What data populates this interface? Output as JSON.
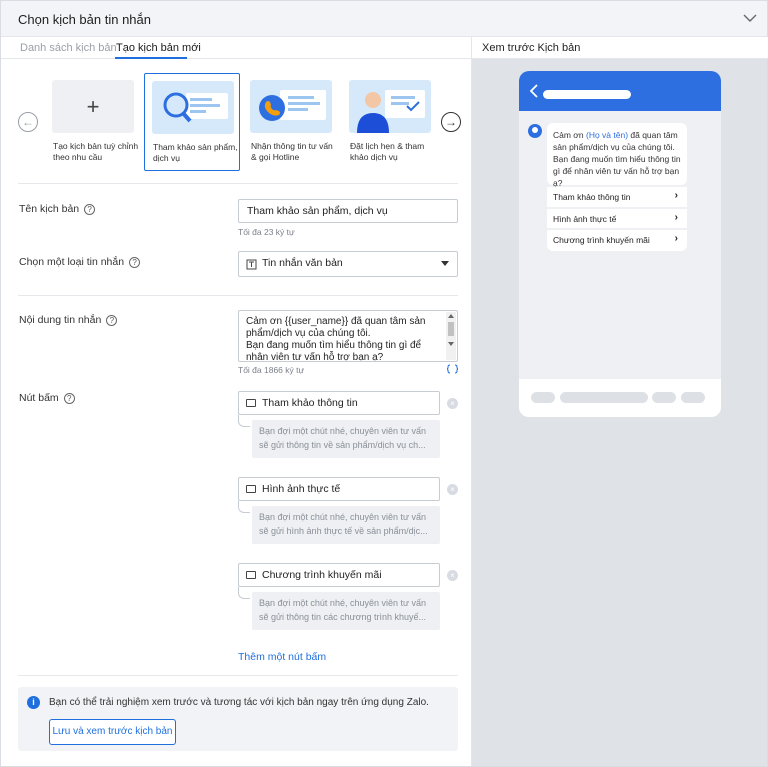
{
  "header": {
    "title": "Chọn kịch bản tin nhắn"
  },
  "tabs": [
    {
      "label": "Danh sách kịch bản"
    },
    {
      "label": "Tạo kịch bản mới"
    }
  ],
  "preview": {
    "title": "Xem trước Kịch bản"
  },
  "templates": [
    {
      "label": "Tạo kịch bản tuỳ chỉnh theo nhu cầu"
    },
    {
      "label": "Tham khảo sản phẩm, dịch vụ"
    },
    {
      "label": "Nhận thông tin tư vấn & gọi Hotline"
    },
    {
      "label": "Đặt lịch hẹn & tham khảo dịch vụ"
    }
  ],
  "form": {
    "name_label": "Tên kịch bản",
    "name_value": "Tham khảo sản phẩm, dịch vụ",
    "name_hint": "Tối đa 23 ký tự",
    "type_label": "Chọn một loại tin nhắn",
    "type_value": "Tin nhắn văn bản",
    "content_label": "Nội dung tin nhắn",
    "content_value": "Cảm ơn {{user_name}} đã quan tâm sản phẩm/dịch vụ của chúng tôi.\nBạn đang muốn tìm hiểu thông tin gì để nhân viên tư vấn hỗ trợ bạn ạ?",
    "content_hint": "Tối đa 1866 ký tự",
    "buttons_label": "Nút bấm",
    "buttons": [
      {
        "label": "Tham khảo thông tin",
        "reply": "Bạn đợi một chút nhé, chuyên viên tư vấn sẽ gửi thông tin về sản phẩm/dịch vụ ch..."
      },
      {
        "label": "Hình ảnh thực tế",
        "reply": "Bạn đợi một chút nhé, chuyên viên tư vấn sẽ gửi hình ảnh thực tế về sản phẩm/dịc..."
      },
      {
        "label": "Chương trình khuyến mãi",
        "reply": "Bạn đợi một chút nhé, chuyên viên tư vấn sẽ gửi thông tin các chương trình khuyế..."
      }
    ],
    "add_button": "Thêm một nút bấm"
  },
  "notice": {
    "text": "Bạn có thể trải nghiệm xem trước và tương tác với kịch bản ngay trên ứng dụng Zalo.",
    "button": "Lưu và xem trước kịch bản"
  },
  "phone": {
    "msg_prefix": "Cảm ơn ",
    "msg_highlight": "(Họ và tên)",
    "msg_rest": " đã quan tâm sản phẩm/dịch vụ của chúng tôi. Bạn đang muốn tìm hiểu thông tin gì để nhân viên tư vấn hỗ trợ bạn ạ?",
    "quick_replies": [
      "Tham khảo thông tin",
      "Hình ảnh thực tế",
      "Chương trình khuyến mãi"
    ]
  },
  "colors": {
    "accent": "#1f6fde",
    "phone_bar": "#2d6fe0"
  }
}
